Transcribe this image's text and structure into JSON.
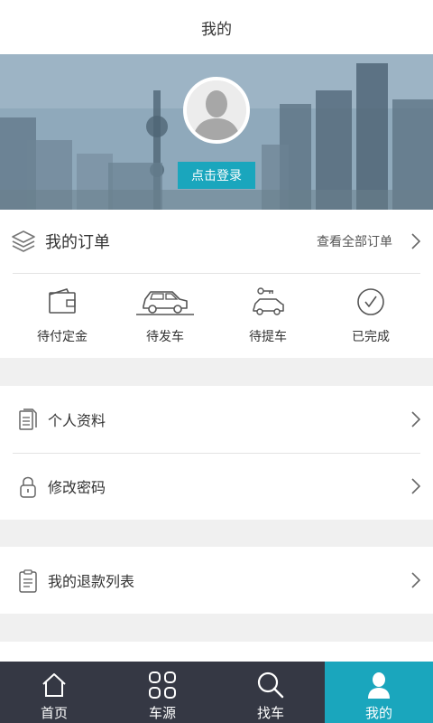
{
  "header": {
    "title": "我的"
  },
  "profile": {
    "login_label": "点击登录"
  },
  "orders": {
    "title": "我的订单",
    "view_all": "查看全部订单",
    "statuses": [
      {
        "label": "待付定金",
        "icon": "wallet-icon"
      },
      {
        "label": "待发车",
        "icon": "car-icon"
      },
      {
        "label": "待提车",
        "icon": "car-key-icon"
      },
      {
        "label": "已完成",
        "icon": "check-circle-icon"
      }
    ]
  },
  "menu": {
    "profile": "个人资料",
    "password": "修改密码",
    "refunds": "我的退款列表"
  },
  "tabbar": {
    "items": [
      {
        "label": "首页",
        "icon": "home-icon"
      },
      {
        "label": "车源",
        "icon": "grid-icon"
      },
      {
        "label": "找车",
        "icon": "search-icon"
      },
      {
        "label": "我的",
        "icon": "user-icon"
      }
    ],
    "active_index": 3
  },
  "colors": {
    "accent": "#1aa6bd",
    "tabbar_bg": "#353844"
  }
}
